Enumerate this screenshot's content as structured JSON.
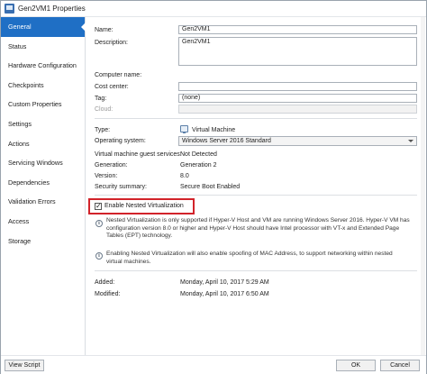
{
  "window": {
    "title": "Gen2VM1 Properties"
  },
  "sidebar": {
    "items": [
      {
        "label": "General"
      },
      {
        "label": "Status"
      },
      {
        "label": "Hardware Configuration"
      },
      {
        "label": "Checkpoints"
      },
      {
        "label": "Custom Properties"
      },
      {
        "label": "Settings"
      },
      {
        "label": "Actions"
      },
      {
        "label": "Servicing Windows"
      },
      {
        "label": "Dependencies"
      },
      {
        "label": "Validation Errors"
      },
      {
        "label": "Access"
      },
      {
        "label": "Storage"
      }
    ]
  },
  "general": {
    "name_label": "Name:",
    "name_value": "Gen2VM1",
    "description_label": "Description:",
    "description_value": "Gen2VM1",
    "computer_name_label": "Computer name:",
    "cost_center_label": "Cost center:",
    "cost_center_value": "",
    "tag_label": "Tag:",
    "tag_value": "(none)",
    "cloud_label": "Cloud:",
    "cloud_value": "",
    "type_label": "Type:",
    "type_value": "Virtual Machine",
    "os_label": "Operating system:",
    "os_value": "Windows Server 2016 Standard",
    "guest_services_label": "Virtual machine guest services:",
    "guest_services_value": "Not Detected",
    "generation_label": "Generation:",
    "generation_value": "Generation 2",
    "version_label": "Version:",
    "version_value": "8.0",
    "security_label": "Security summary:",
    "security_value": "Secure Boot Enabled",
    "nested_checkbox_label": "Enable Nested Virtualization",
    "nested_checked": true,
    "note1_line1": "Nested Virtualization is only supported if Hyper-V Host and VM are running Windows Server 2016. Hyper-V VM has",
    "note1_line2": "configuration version 8.0 or higher and Hyper-V Host should have Intel processor with VT-x and Extended Page",
    "note1_line3": "Tables (EPT) technology.",
    "note2_line1": "Enabling Nested Virtualization will also enable spoofing of MAC Address, to support networking within nested",
    "note2_line2": "virtual machines.",
    "added_label": "Added:",
    "added_value": "Monday, April 10, 2017 5:29 AM",
    "modified_label": "Modified:",
    "modified_value": "Monday, April 10, 2017 6:50 AM"
  },
  "footer": {
    "view_script": "View Script",
    "ok": "OK",
    "cancel": "Cancel"
  },
  "colors": {
    "accent": "#1f6fc5",
    "highlight": "#d2232a"
  },
  "icons": {
    "title": "window-icon",
    "vm": "virtual-machine-icon",
    "info": "info-icon"
  }
}
